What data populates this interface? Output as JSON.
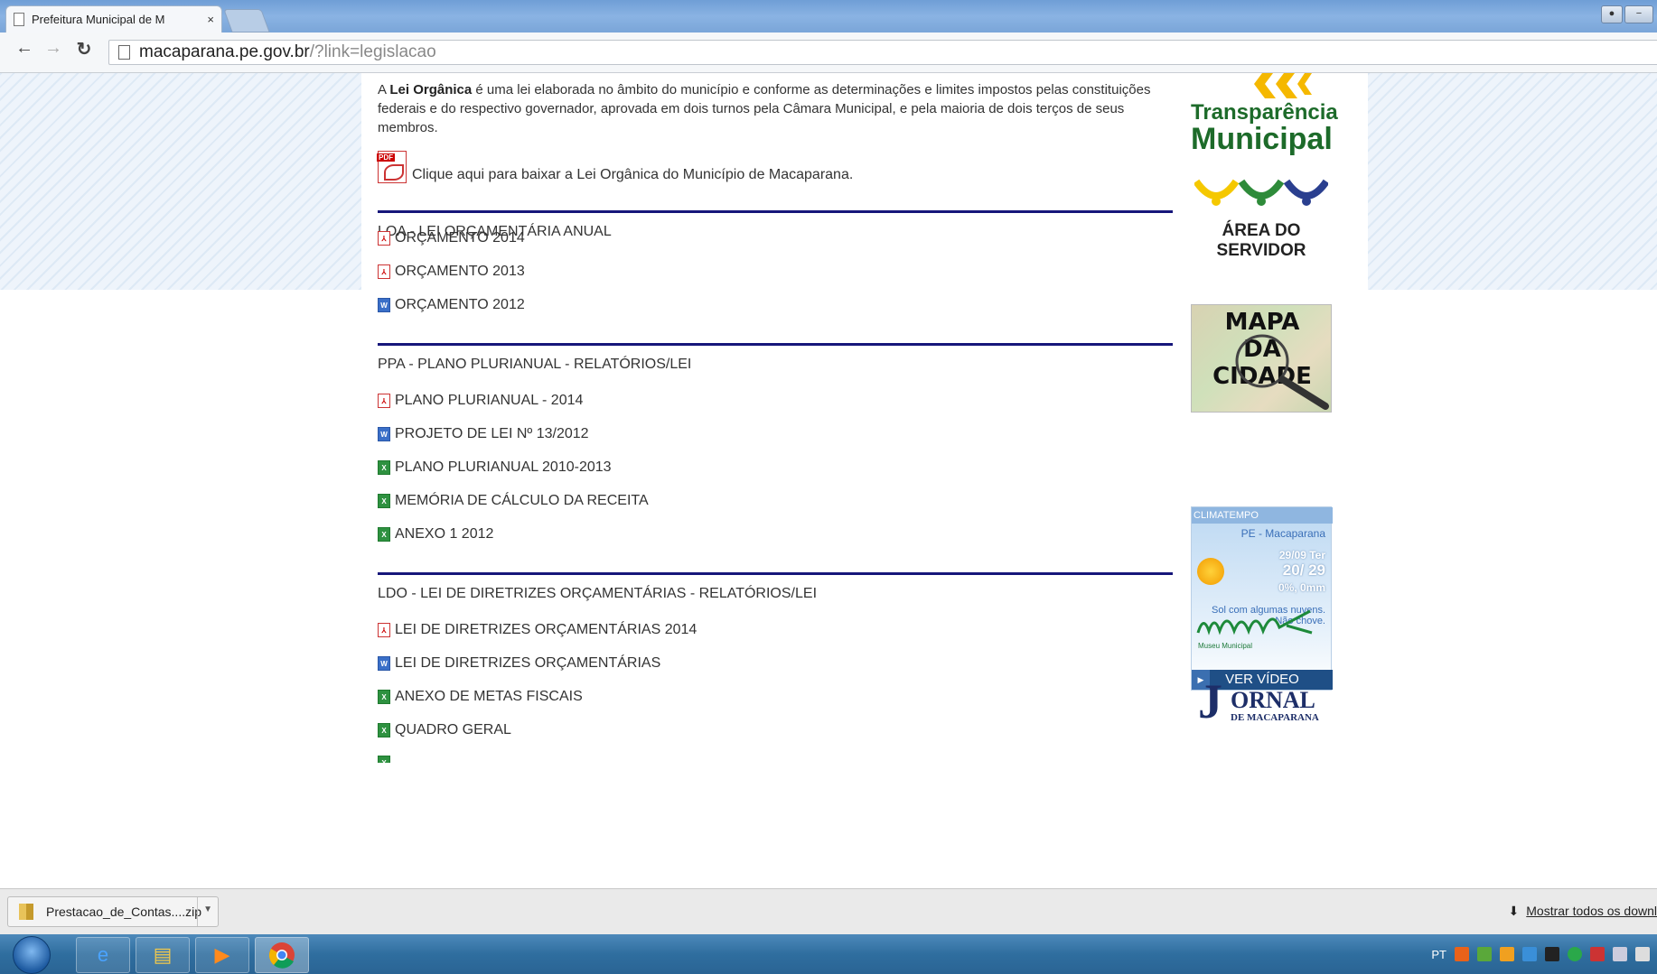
{
  "browser": {
    "tab_title": "Prefeitura Municipal de M",
    "tab_close": "×",
    "url_host": "macaparana.pe.gov.br",
    "url_path": "/?link=legislacao"
  },
  "intro": {
    "prefix": "A ",
    "bold": "Lei Orgânica",
    "text": " é uma lei elaborada no âmbito do município e conforme as determinações e limites impostos pelas constituições federais e do respectivo governador, aprovada em dois turnos pela Câmara Municipal, e pela maioria de dois terços de seus membros.",
    "download_link": "Clique aqui para baixar a Lei Orgânica do Município de Macaparana."
  },
  "sections": [
    {
      "title": "LOA - LEI ORÇAMENTÁRIA ANUAL",
      "items": [
        {
          "label": "ORÇAMENTO 2014",
          "type": "pdf"
        },
        {
          "label": "ORÇAMENTO 2013",
          "type": "pdf"
        },
        {
          "label": "ORÇAMENTO 2012",
          "type": "word"
        }
      ]
    },
    {
      "title": "PPA - PLANO PLURIANUAL - RELATÓRIOS/LEI",
      "items": [
        {
          "label": "PLANO PLURIANUAL - 2014",
          "type": "pdf"
        },
        {
          "label": "PROJETO DE LEI Nº 13/2012",
          "type": "word"
        },
        {
          "label": "PLANO PLURIANUAL 2010-2013",
          "type": "excel"
        },
        {
          "label": "MEMÓRIA DE CÁLCULO DA RECEITA",
          "type": "excel"
        },
        {
          "label": "ANEXO 1 2012",
          "type": "excel"
        }
      ]
    },
    {
      "title": "LDO - LEI DE DIRETRIZES ORÇAMENTÁRIAS - RELATÓRIOS/LEI",
      "items": [
        {
          "label": "LEI DE DIRETRIZES ORÇAMENTÁRIAS 2014",
          "type": "pdf"
        },
        {
          "label": "LEI DE DIRETRIZES ORÇAMENTÁRIAS",
          "type": "word"
        },
        {
          "label": "ANEXO DE METAS FISCAIS",
          "type": "excel"
        },
        {
          "label": "QUADRO GERAL",
          "type": "excel"
        }
      ]
    }
  ],
  "sidebar": {
    "transparencia_line1": "Transparência",
    "transparencia_line2": "Municipal",
    "servidor": "ÁREA DO SERVIDOR",
    "mapa_line1": "MAPA",
    "mapa_line2": "DA",
    "mapa_line3": "CIDADE",
    "clima": {
      "brand": "CLIMATEMPO",
      "location": "PE - Macaparana",
      "date": "29/09 Ter",
      "temps": "20/ 29",
      "rain": "0%, 0mm",
      "description": "Sol com algumas nuvens. Não chove.",
      "video": "VER VÍDEO"
    },
    "museu_caption": "Museu Municipal",
    "jornal_j": "J",
    "jornal_rest": "ORNAL",
    "jornal_sub": "DE MACAPARANA"
  },
  "downloads": {
    "file": "Prestacao_de_Contas....zip",
    "show_all": "Mostrar todos os downl"
  },
  "taskbar": {
    "lang": "PT"
  },
  "colors": {
    "section_rule": "#16167a",
    "brand_green": "#1d6b2a",
    "jornal_navy": "#1d2e68"
  }
}
